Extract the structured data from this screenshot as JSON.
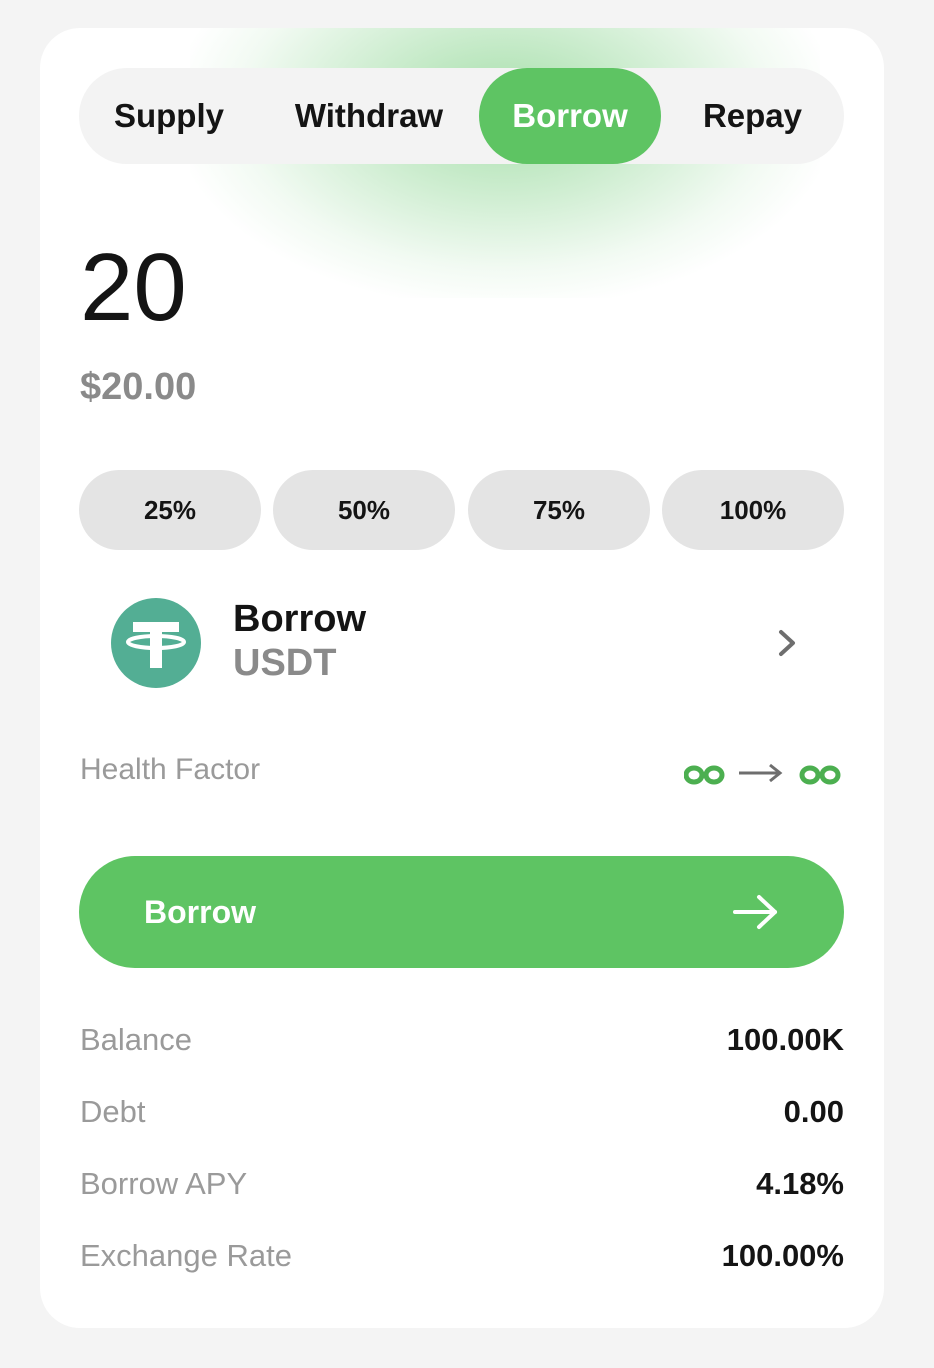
{
  "tabs": [
    {
      "label": "Supply"
    },
    {
      "label": "Withdraw"
    },
    {
      "label": "Borrow",
      "active": true
    },
    {
      "label": "Repay"
    }
  ],
  "amount": {
    "value": "20",
    "usd": "$20.00"
  },
  "percent_buttons": [
    "25%",
    "50%",
    "75%",
    "100%"
  ],
  "asset": {
    "action": "Borrow",
    "symbol": "USDT",
    "icon": "tether-logo",
    "icon_color": "#53ae94"
  },
  "health_factor": {
    "label": "Health Factor",
    "from": "∞",
    "to": "∞"
  },
  "primary_button": {
    "label": "Borrow"
  },
  "info": [
    {
      "label": "Balance",
      "value": "100.00K"
    },
    {
      "label": "Debt",
      "value": "0.00"
    },
    {
      "label": "Borrow APY",
      "value": "4.18%"
    },
    {
      "label": "Exchange Rate",
      "value": "100.00%"
    }
  ],
  "colors": {
    "accent": "#5ec463",
    "muted_text": "#9a9a9a",
    "text": "#141414"
  }
}
